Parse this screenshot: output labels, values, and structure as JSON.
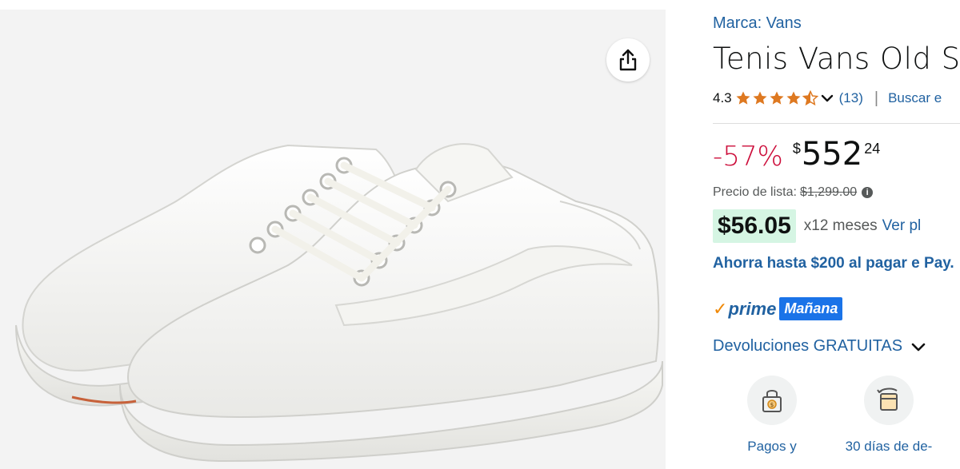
{
  "product": {
    "brand": "Marca: Vans",
    "title": "Tenis Vans Old Sk",
    "rating": "4.3",
    "rating_stars": 4.3,
    "rating_count": "(13)",
    "separator": "|",
    "search_link": "Buscar e"
  },
  "pricing": {
    "discount": "-57%",
    "currency": "$",
    "price_whole": "552",
    "price_cents": "24",
    "list_price_label": "Precio de lista:",
    "list_price": "$1,299.00",
    "info_glyph": "i",
    "installment_amount": "$56.05",
    "installment_term": "x12 meses",
    "installment_link": "Ver pl",
    "promo_text": "Ahorra hasta $200 al pagar e Pay."
  },
  "delivery": {
    "prime_check": "✓",
    "prime_label": "prime",
    "prime_badge": "Mañana",
    "returns": "Devoluciones GRATUITAS"
  },
  "features": [
    {
      "label": "Pagos y",
      "icon": "secure-payment-icon"
    },
    {
      "label": "30 días de de-",
      "icon": "returns-icon"
    }
  ],
  "colors": {
    "link": "#2162a1",
    "discount": "#cc0c39",
    "prime_check": "#f08804",
    "prime_badge": "#1a73e8",
    "installment_bg": "#d5f5e3"
  }
}
